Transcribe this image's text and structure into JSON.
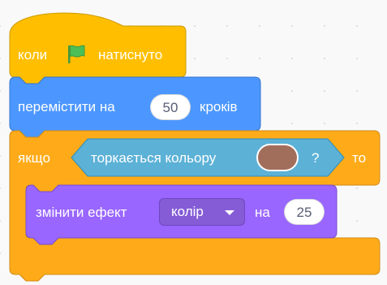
{
  "when_flag_clicked": {
    "before": "коли",
    "after": "натиснуто",
    "flag_icon_color": "#4cbf56"
  },
  "move_block": {
    "label": "перемістити на",
    "steps": "50",
    "unit": "кроків"
  },
  "if_block": {
    "keyword": "якщо",
    "then": "то"
  },
  "touching_color": {
    "label": "торкається кольору",
    "question": "?",
    "color_value": "#a26e5c"
  },
  "change_effect": {
    "label": "змінити ефект",
    "effect": "колір",
    "by": "на",
    "amount": "25"
  },
  "colors": {
    "events": "#ffbf00",
    "control": "#ffab19",
    "motion": "#4c97ff",
    "sensing": "#5cb1d6",
    "looks": "#9966ff"
  }
}
